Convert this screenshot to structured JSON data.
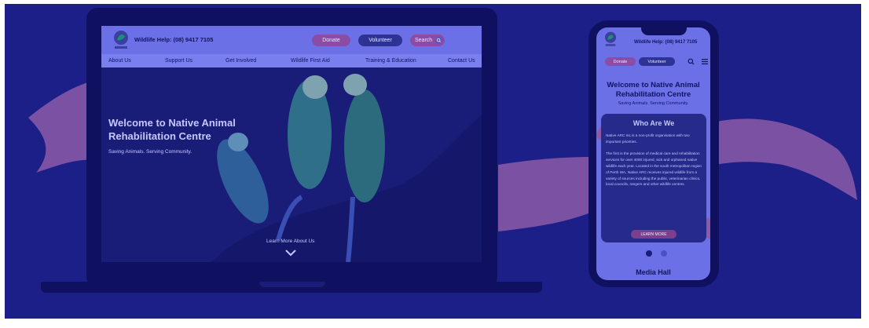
{
  "colors": {
    "background": "#1b1f87",
    "brush": "#8b5aa8",
    "device": "#0f1160",
    "header": "#6b70e6",
    "donate": "#8a4ca4",
    "volunteer": "#2d3395"
  },
  "desktop": {
    "helpline": "Wildlife Help: (08) 9417 7105",
    "donate_label": "Donate",
    "volunteer_label": "Volunteer",
    "search_label": "Search",
    "search_icon": "search-icon",
    "nav": [
      "About Us",
      "Support Us",
      "Get Involved",
      "Wildlife First Aid",
      "Training & Education",
      "Contact Us"
    ],
    "hero": {
      "title": "Welcome to Native Animal Rehabilitation Centre",
      "subtitle": "Saving Animals. Serving Community.",
      "link": "Learn More About Us",
      "link_icon": "chevron-down-icon"
    }
  },
  "mobile": {
    "helpline": "Wildlife Help: (08) 9417 7105",
    "donate_label": "Donate",
    "volunteer_label": "Volunteer",
    "search_icon": "search-icon",
    "menu_icon": "menu-icon",
    "title": "Welcome to Native Animal Rehabilitation Centre",
    "subtitle": "Saving Animals. Serving Community.",
    "card": {
      "title": "Who Are We",
      "body": "Native ARC Inc is a non-profit organisation with two important priorities.\n\nThe first is the provision of medical care and rehabilitation services for over 4000 injured, sick and orphaned native wildlife each year. Located in the south metropolitan region of Perth WA, Native ARC receives injured wildlife from a variety of sources including the public, veterinarian clinics, local councils, rangers and other wildlife centres.",
      "button": "LEARN MORE"
    },
    "carousel": {
      "slides": 2,
      "active": 1
    },
    "next_section": "Media Hall"
  }
}
